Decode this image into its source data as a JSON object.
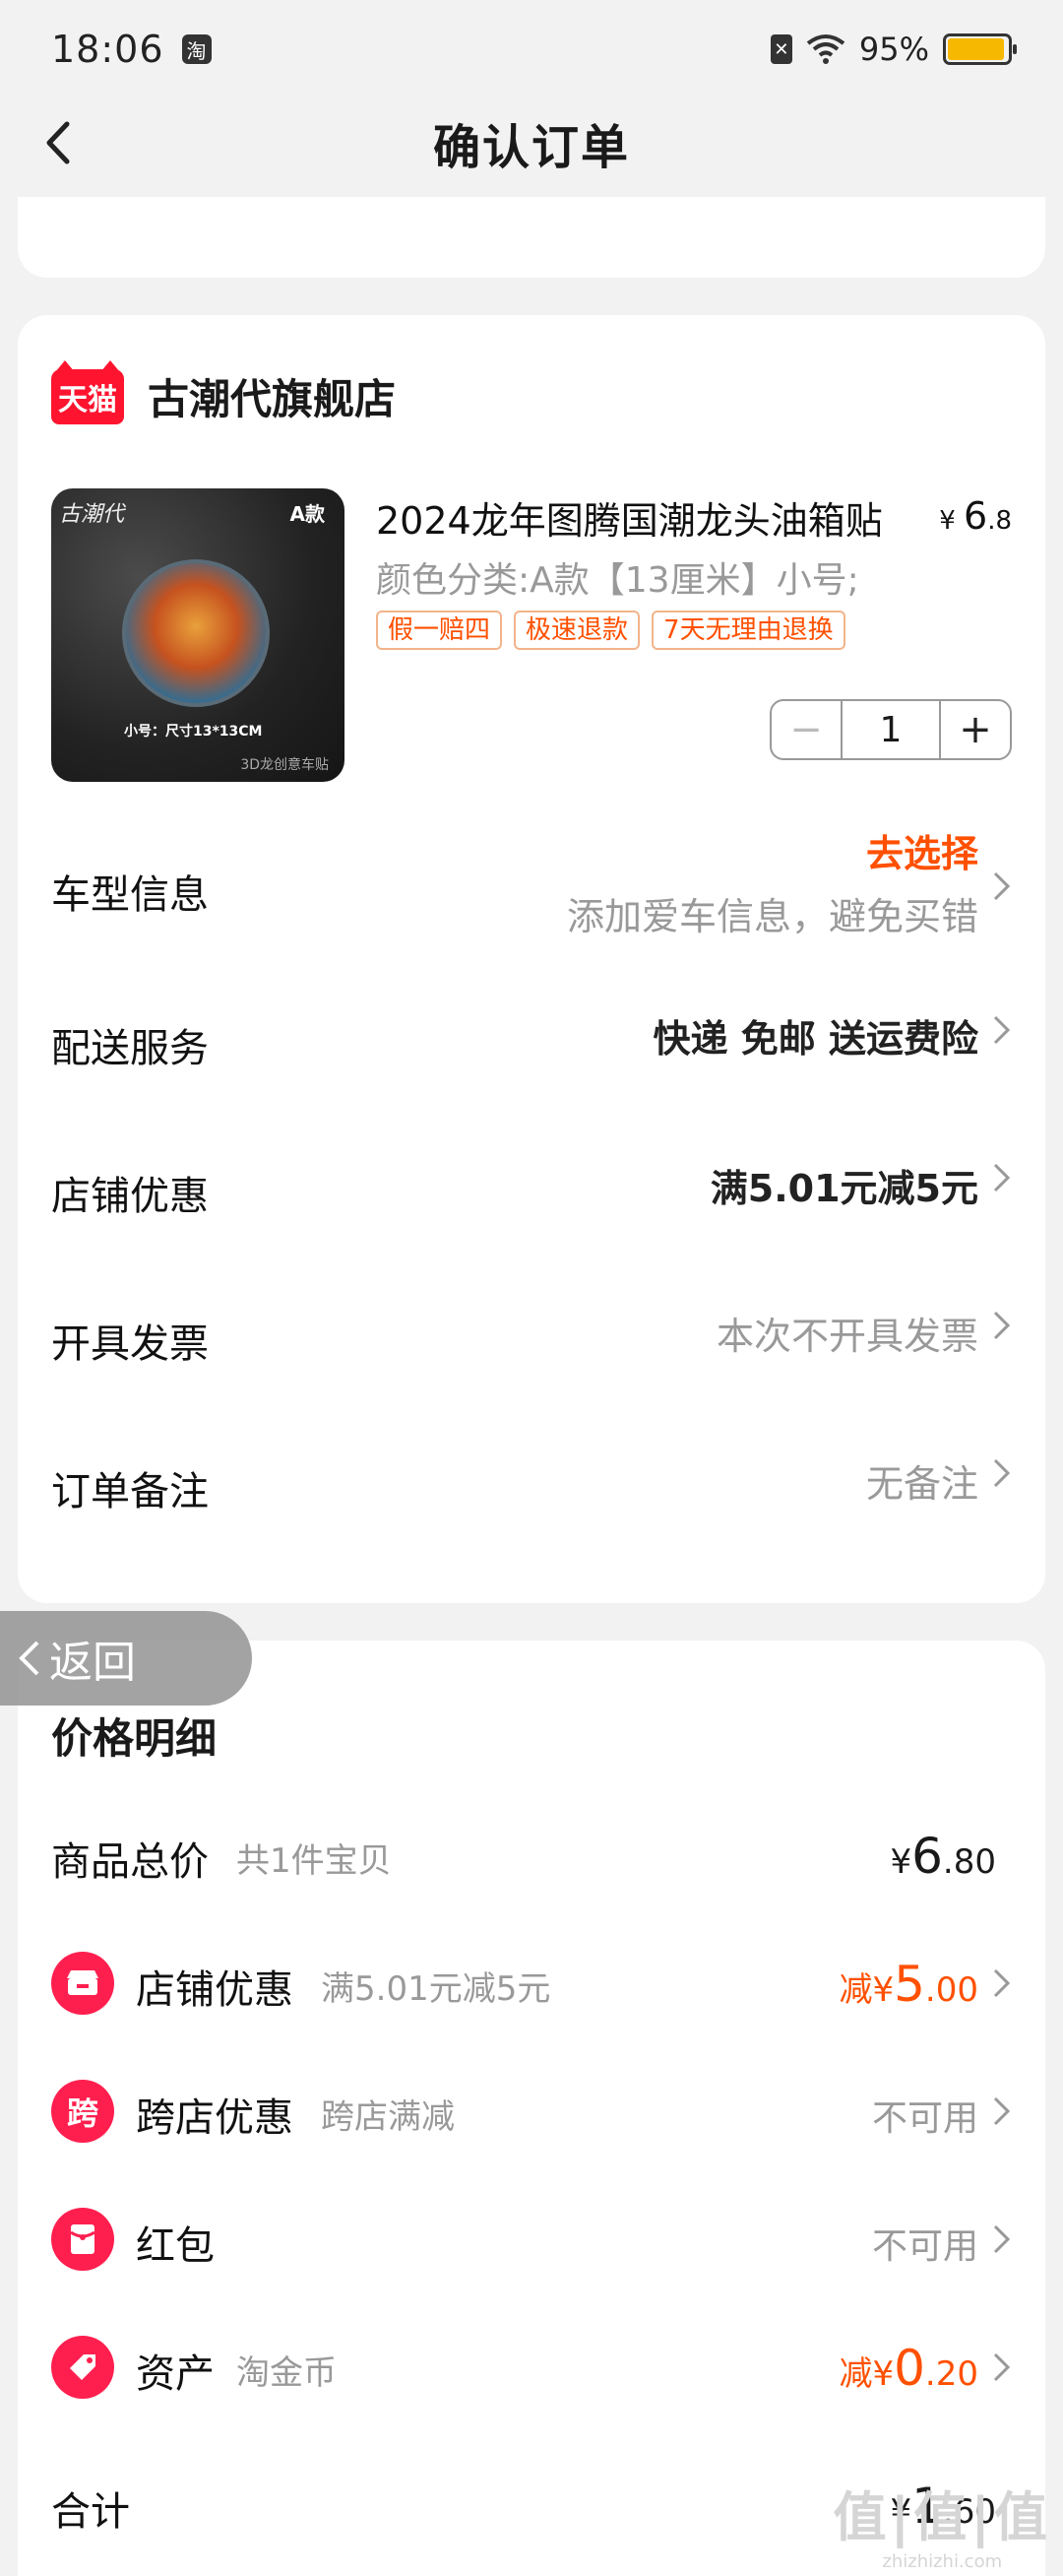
{
  "status_bar": {
    "time": "18:06",
    "app_icon": "淘",
    "battery": "95%",
    "battery_level": 0.95
  },
  "nav": {
    "title": "确认订单",
    "back_icon": "chevron-left-icon"
  },
  "shop": {
    "logo_text": "天猫",
    "name": "古潮代旗舰店"
  },
  "product": {
    "title": "2024龙年图腾国潮龙头油箱贴",
    "price_symbol": "¥",
    "price_int": "6",
    "price_dec": ".8",
    "sku": "颜色分类:A款【13厘米】小号;",
    "tags": [
      "假一赔四",
      "极速退款",
      "7天无理由退换"
    ],
    "quantity": "1",
    "image": {
      "badge": "A款",
      "size_text": "小号：尺寸13*13CM",
      "brand": "3D龙创意车贴"
    }
  },
  "rows": {
    "car_model": {
      "label": "车型信息",
      "action": "去选择",
      "hint": "添加爱车信息，避免买错"
    },
    "delivery": {
      "label": "配送服务",
      "value": "快递 免邮 送运费险"
    },
    "shop_discount": {
      "label": "店铺优惠",
      "value": "满5.01元减5元"
    },
    "invoice": {
      "label": "开具发票",
      "value": "本次不开具发票"
    },
    "remark": {
      "label": "订单备注",
      "value": "无备注"
    }
  },
  "float_back": {
    "label": "返回"
  },
  "price_detail": {
    "title": "价格明细",
    "total_goods": {
      "label": "商品总价",
      "sub": "共1件宝贝",
      "symbol": "¥",
      "int": "6",
      "dec": ".80"
    },
    "shop_discount": {
      "icon": "store-icon",
      "label": "店铺优惠",
      "sub": "满5.01元减5元",
      "prefix": "减",
      "symbol": "¥",
      "int": "5",
      "dec": ".00"
    },
    "cross_shop": {
      "icon_text": "跨",
      "label": "跨店优惠",
      "sub": "跨店满减",
      "value": "不可用"
    },
    "red_packet": {
      "icon": "red-packet-icon",
      "label": "红包",
      "value": "不可用"
    },
    "assets": {
      "icon": "tag-icon",
      "label": "资产",
      "sub": "淘金币",
      "prefix": "减",
      "symbol": "¥",
      "int": "0",
      "dec": ".20"
    },
    "subtotal": {
      "label": "合计",
      "symbol": "¥",
      "int": "1",
      "dec": ".60"
    }
  },
  "watermark": {
    "big": "值|值|值",
    "small": "zhizhizhi.com"
  },
  "colors": {
    "accent": "#ff5000",
    "tmall_red": "#ff1430",
    "icon_red": "#ff1f4f"
  }
}
